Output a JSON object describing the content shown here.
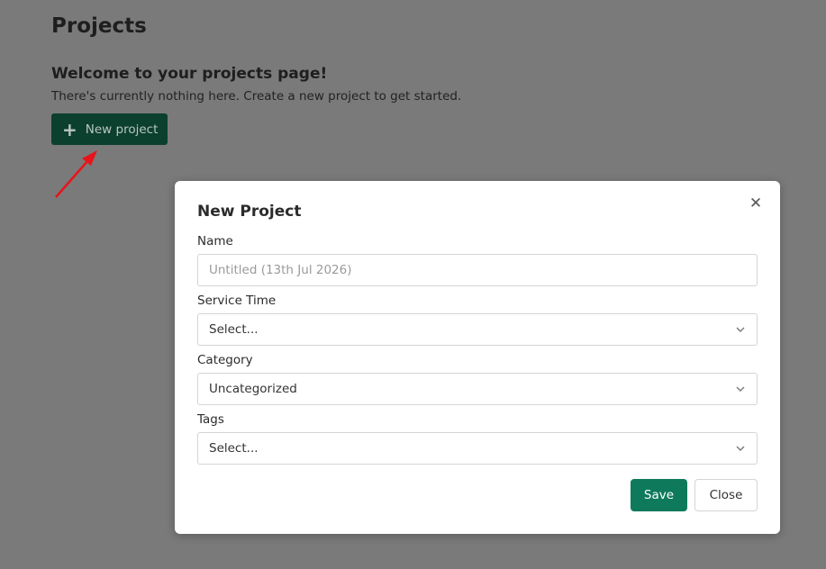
{
  "page": {
    "title": "Projects",
    "welcome_heading": "Welcome to your projects page!",
    "welcome_text": "There's currently nothing here. Create a new project to get started.",
    "new_project_label": "New project"
  },
  "modal": {
    "title": "New Project",
    "close_icon": "close-icon",
    "fields": {
      "name": {
        "label": "Name",
        "placeholder": "Untitled (13th Jul 2026)",
        "value": ""
      },
      "service_time": {
        "label": "Service Time",
        "value": "Select..."
      },
      "category": {
        "label": "Category",
        "value": "Uncategorized"
      },
      "tags": {
        "label": "Tags",
        "value": "Select..."
      }
    },
    "save_label": "Save",
    "close_label": "Close"
  },
  "colors": {
    "overlay_background": "#7a7a7a",
    "new_project_button": "#0b3f2e",
    "save_button": "#0e7a5b",
    "annotation_arrow": "#e8141c"
  }
}
